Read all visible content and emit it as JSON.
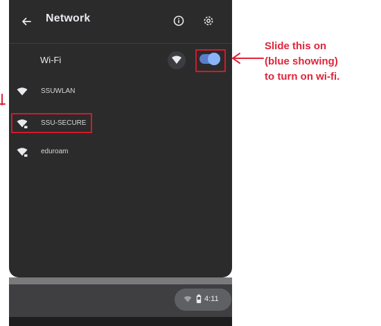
{
  "panel": {
    "title": "Network",
    "wifi_label": "Wi-Fi",
    "wifi_enabled": true
  },
  "networks": [
    {
      "name": "SSUWLAN",
      "secured": false
    },
    {
      "name": "SSU-SECURE",
      "secured": true
    },
    {
      "name": "eduroam",
      "secured": true
    }
  ],
  "shelf": {
    "time": "4:11"
  },
  "annotation": {
    "lines": [
      "Slide this on",
      "(blue showing)",
      "to turn on wi-fi."
    ]
  },
  "colors": {
    "panel_bg": "#2b2b2c",
    "accent": "#8ab4f8",
    "annotation": "#e0243a"
  },
  "icons": [
    "back-arrow-icon",
    "info-icon",
    "gear-icon",
    "wifi-icon",
    "wifi-lock-icon",
    "battery-icon"
  ]
}
